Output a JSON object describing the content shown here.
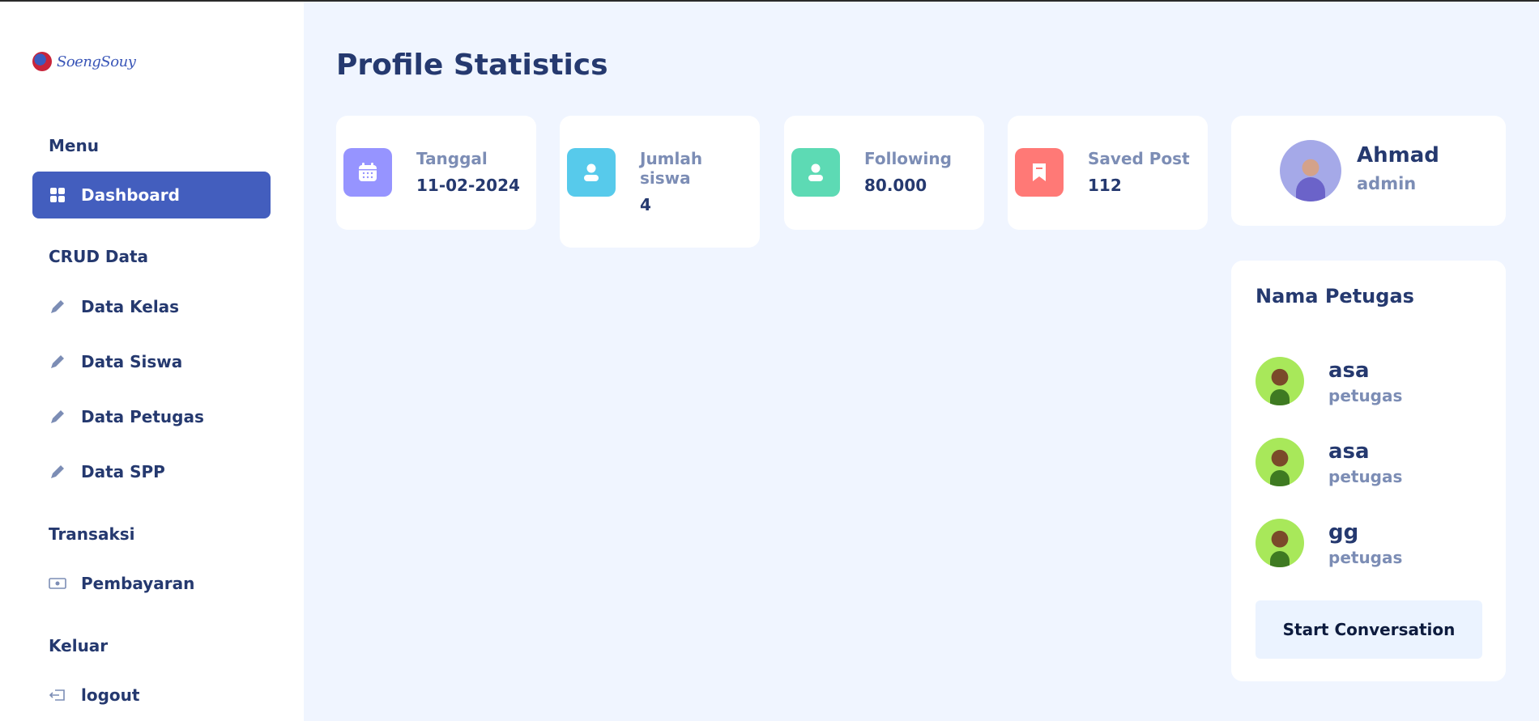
{
  "brand": {
    "logo_text": "SoengSouy"
  },
  "sidebar": {
    "sections": [
      {
        "title": "Menu"
      },
      {
        "title": "CRUD Data"
      },
      {
        "title": "Transaksi"
      },
      {
        "title": "Keluar"
      }
    ],
    "items": [
      {
        "label": "Dashboard",
        "icon": "grid-icon",
        "active": true
      },
      {
        "label": "Data Kelas",
        "icon": "pencil-icon"
      },
      {
        "label": "Data Siswa",
        "icon": "pencil-icon"
      },
      {
        "label": "Data Petugas",
        "icon": "pencil-icon"
      },
      {
        "label": "Data SPP",
        "icon": "pencil-icon"
      },
      {
        "label": "Pembayaran",
        "icon": "cash-icon"
      },
      {
        "label": "logout",
        "icon": "logout-icon"
      }
    ]
  },
  "main": {
    "title": "Profile Statistics",
    "stats": [
      {
        "label": "Tanggal",
        "value": "11-02-2024",
        "icon": "calendar-icon",
        "color": "#9694ff"
      },
      {
        "label": "Jumlah siswa",
        "value": "4",
        "icon": "person-icon",
        "color": "#57caeb"
      },
      {
        "label": "Following",
        "value": "80.000",
        "icon": "person-icon",
        "color": "#5ddab4"
      },
      {
        "label": "Saved Post",
        "value": "112",
        "icon": "bookmark-icon",
        "color": "#ff7976"
      }
    ]
  },
  "profile": {
    "name": "Ahmad",
    "role": "admin"
  },
  "staff": {
    "title": "Nama Petugas",
    "members": [
      {
        "name": "asa",
        "role": "petugas"
      },
      {
        "name": "asa",
        "role": "petugas"
      },
      {
        "name": "gg",
        "role": "petugas"
      }
    ],
    "button_label": "Start Conversation"
  },
  "colors": {
    "primary": "#435ebe",
    "heading": "#25396f",
    "muted": "#7c8db5",
    "background": "#f0f5ff"
  }
}
